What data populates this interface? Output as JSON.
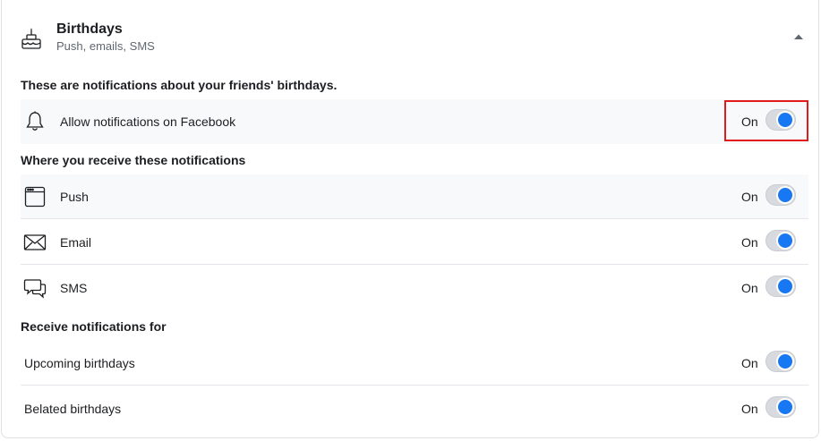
{
  "header": {
    "title": "Birthdays",
    "subtitle": "Push, emails, SMS",
    "icon": "birthday-cake-icon",
    "collapse_icon": "caret-up-icon"
  },
  "intro": "These are notifications about your friends' birthdays.",
  "allow_row": {
    "icon": "bell-icon",
    "label": "Allow notifications on Facebook",
    "state": "On",
    "enabled": true
  },
  "channels_heading": "Where you receive these notifications",
  "channels": [
    {
      "icon": "browser-window-icon",
      "label": "Push",
      "state": "On",
      "enabled": true
    },
    {
      "icon": "envelope-icon",
      "label": "Email",
      "state": "On",
      "enabled": true
    },
    {
      "icon": "chat-bubbles-icon",
      "label": "SMS",
      "state": "On",
      "enabled": true
    }
  ],
  "receive_heading": "Receive notifications for",
  "receive_for": [
    {
      "label": "Upcoming birthdays",
      "state": "On",
      "enabled": true
    },
    {
      "label": "Belated birthdays",
      "state": "On",
      "enabled": true
    }
  ],
  "colors": {
    "toggle_on": "#1877f2",
    "highlight": "#e11b1b"
  }
}
